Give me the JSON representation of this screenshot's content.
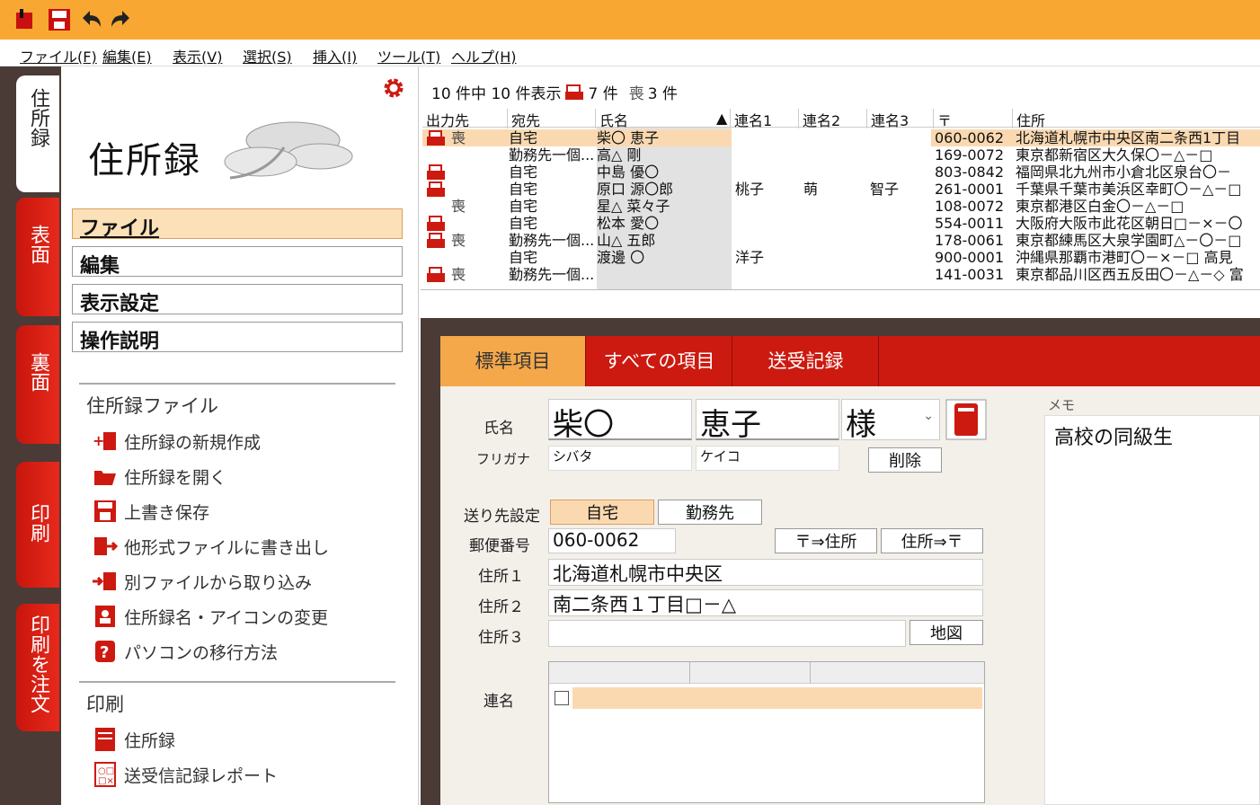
{
  "menu": [
    "ファイル(F)",
    "編集(E)",
    "表示(V)",
    "選択(S)",
    "挿入(I)",
    "ツール(T)",
    "ヘルプ(H)"
  ],
  "vtabs": [
    "住所録",
    "表面",
    "裏面",
    "印刷",
    "印刷を注文"
  ],
  "sidebar": {
    "title": "住所録",
    "categories": [
      "ファイル",
      "編集",
      "表示設定",
      "操作説明"
    ],
    "section1": "住所録ファイル",
    "file_actions": [
      "住所録の新規作成",
      "住所録を開く",
      "上書き保存",
      "他形式ファイルに書き出し",
      "別ファイルから取り込み",
      "住所録名・アイコンの変更",
      "パソコンの移行方法"
    ],
    "section2": "印刷",
    "print_actions": [
      "住所録",
      "送受信記録レポート"
    ]
  },
  "status": {
    "prefix": "10 件中 10 件表示",
    "print_count": "7 件",
    "mourning_icon": "喪",
    "mourning_count": "3 件"
  },
  "grid": {
    "headers": [
      "出力先",
      "宛先",
      "氏名",
      "連名1",
      "連名2",
      "連名3",
      "〒",
      "住所"
    ],
    "rows": [
      {
        "print": true,
        "mark": "喪",
        "dest": "自宅",
        "name": "柴〇 恵子",
        "r1": "",
        "r2": "",
        "r3": "",
        "zip": "060-0062",
        "addr": "北海道札幌市中央区南二条西1丁目"
      },
      {
        "print": false,
        "mark": "",
        "dest": "勤務先一個...",
        "name": "高△ 剛",
        "r1": "",
        "r2": "",
        "r3": "",
        "zip": "169-0072",
        "addr": "東京都新宿区大久保〇－△－□"
      },
      {
        "print": true,
        "mark": "",
        "dest": "自宅",
        "name": "中島 優〇",
        "r1": "",
        "r2": "",
        "r3": "",
        "zip": "803-0842",
        "addr": "福岡県北九州市小倉北区泉台〇－"
      },
      {
        "print": true,
        "mark": "",
        "dest": "自宅",
        "name": "原口 源〇郎",
        "r1": "桃子",
        "r2": "萌",
        "r3": "智子",
        "zip": "261-0001",
        "addr": "千葉県千葉市美浜区幸町〇－△－□"
      },
      {
        "print": false,
        "mark": "喪",
        "dest": "自宅",
        "name": "星△ 菜々子",
        "r1": "",
        "r2": "",
        "r3": "",
        "zip": "108-0072",
        "addr": "東京都港区白金〇－△－□"
      },
      {
        "print": true,
        "mark": "",
        "dest": "自宅",
        "name": "松本 愛〇",
        "r1": "",
        "r2": "",
        "r3": "",
        "zip": "554-0011",
        "addr": "大阪府大阪市此花区朝日□－×－〇"
      },
      {
        "print": true,
        "mark": "喪",
        "dest": "勤務先一個...",
        "name": "山△ 五郎",
        "r1": "",
        "r2": "",
        "r3": "",
        "zip": "178-0061",
        "addr": "東京都練馬区大泉学園町△－〇－□"
      },
      {
        "print": false,
        "mark": "",
        "dest": "自宅",
        "name": "渡邊 〇",
        "r1": "洋子",
        "r2": "",
        "r3": "",
        "zip": "900-0001",
        "addr": "沖縄県那覇市港町〇－×－□ 高見"
      },
      {
        "print": true,
        "mark": "喪",
        "dest": "勤務先一個...",
        "name": "",
        "r1": "",
        "r2": "",
        "r3": "",
        "zip": "141-0031",
        "addr": "東京都品川区西五反田〇－△－◇ 富"
      }
    ]
  },
  "detail": {
    "tabs": [
      "標準項目",
      "すべての項目",
      "送受記録"
    ],
    "labels": {
      "name": "氏名",
      "furigana": "フリガナ",
      "send_to": "送り先設定",
      "postal": "郵便番号",
      "addr1": "住所１",
      "addr2": "住所２",
      "addr3": "住所３",
      "joint": "連名",
      "memo": "メモ"
    },
    "last_name": "柴〇",
    "first_name": "恵子",
    "honorific": "様",
    "kana_last": "シバタ",
    "kana_first": "ケイコ",
    "delete_btn": "削除",
    "home_btn": "自宅",
    "work_btn": "勤務先",
    "postal_value": "060-0062",
    "zip_to_addr": "〒⇒住所",
    "addr_to_zip": "住所⇒〒",
    "addr1": "北海道札幌市中央区",
    "addr2": "南二条西１丁目□－△",
    "addr3": "",
    "map_btn": "地図",
    "memo_text": "高校の同級生"
  },
  "colors": {
    "accent": "#cc1a10",
    "orange": "#f8a832",
    "dark": "#4a3b36"
  }
}
